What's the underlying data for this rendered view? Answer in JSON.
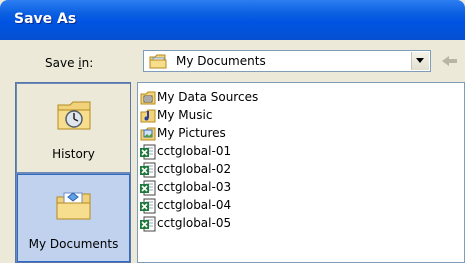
{
  "window": {
    "title": "Save As"
  },
  "toolbar": {
    "save_in_prefix": "Save ",
    "save_in_mnemonic": "i",
    "save_in_suffix": "n:",
    "location": "My Documents"
  },
  "places": [
    {
      "label": "History",
      "icon": "history-icon",
      "selected": false
    },
    {
      "label": "My Documents",
      "icon": "my-documents-icon",
      "selected": true
    }
  ],
  "files": [
    {
      "name": "My Data Sources",
      "icon": "data-sources-folder-icon"
    },
    {
      "name": "My Music",
      "icon": "music-folder-icon"
    },
    {
      "name": "My Pictures",
      "icon": "pictures-folder-icon"
    },
    {
      "name": "cctglobal-01",
      "icon": "excel-file-icon"
    },
    {
      "name": "cctglobal-02",
      "icon": "excel-file-icon"
    },
    {
      "name": "cctglobal-03",
      "icon": "excel-file-icon"
    },
    {
      "name": "cctglobal-04",
      "icon": "excel-file-icon"
    },
    {
      "name": "cctglobal-05",
      "icon": "excel-file-icon"
    }
  ]
}
